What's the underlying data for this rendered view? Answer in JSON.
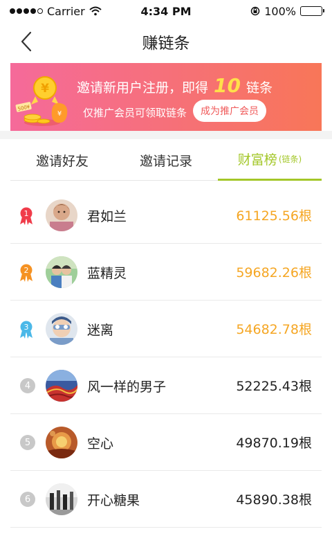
{
  "status_bar": {
    "carrier": "Carrier",
    "time": "4:34 PM",
    "battery": "100%",
    "signal_bars": 4
  },
  "nav": {
    "title": "赚链条"
  },
  "banner": {
    "line1_prefix": "邀请新用户注册，即得",
    "line1_number": "10",
    "line1_suffix": "链条",
    "line2": "仅推广会员可领取链条",
    "button_label": "成为推广会员",
    "badge": "500¥"
  },
  "tabs": [
    {
      "label": "邀请好友"
    },
    {
      "label": "邀请记录"
    },
    {
      "label": "财富榜",
      "sub": "(链条)",
      "active": true
    }
  ],
  "colors": {
    "active_tab": "#a3c728",
    "top_value": "#f5a623",
    "rank1": "#f03c4a",
    "rank2": "#f59223",
    "rank3": "#4bb8e8",
    "rank_other": "#c8c8c8"
  },
  "leaderboard": [
    {
      "rank": "1",
      "name": "君如兰",
      "value": "61125.56根"
    },
    {
      "rank": "2",
      "name": "蓝精灵",
      "value": "59682.26根"
    },
    {
      "rank": "3",
      "name": "迷离",
      "value": "54682.78根"
    },
    {
      "rank": "4",
      "name": "风一样的男子",
      "value": "52225.43根"
    },
    {
      "rank": "5",
      "name": "空心",
      "value": "49870.19根"
    },
    {
      "rank": "6",
      "name": "开心糖果",
      "value": "45890.38根"
    }
  ]
}
